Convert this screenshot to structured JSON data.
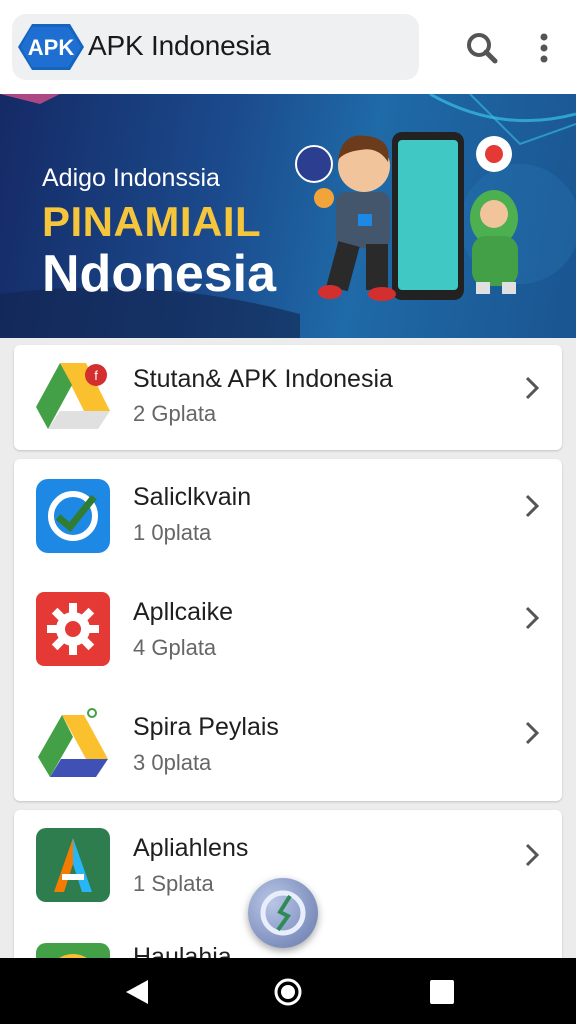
{
  "header": {
    "logo_text": "APK",
    "title": "APK Indonesia",
    "icons": [
      "search-icon",
      "more-vert-icon"
    ]
  },
  "banner": {
    "subtitle": "Adigo Indonssia",
    "title": "PINAMIAIL",
    "title2": "Ndonesia"
  },
  "apps": [
    {
      "name": "Stutan& APK Indonesia",
      "sub": "2 Gplata",
      "icon": "drive-icon"
    },
    {
      "name": "Saliclkvain",
      "sub": "1 0plata",
      "icon": "sync-check-icon"
    },
    {
      "name": "Apllcaike",
      "sub": "4 Gplata",
      "icon": "gear-icon"
    },
    {
      "name": "Spira Peylais",
      "sub": "3 0plata",
      "icon": "drive-icon"
    },
    {
      "name": "Apliahlens",
      "sub": "1 Splata",
      "icon": "a-letter-icon"
    },
    {
      "name": "Haulahia",
      "sub": "",
      "icon": "chrome-icon"
    }
  ],
  "colors": {
    "accent": "#1565c0",
    "banner_gold": "#f5c53b",
    "gear_red": "#e53935",
    "tile_blue": "#1e88e5",
    "tile_green": "#2e7d4f"
  },
  "navbar": {
    "icons": [
      "back-icon",
      "home-icon",
      "recents-icon"
    ]
  }
}
